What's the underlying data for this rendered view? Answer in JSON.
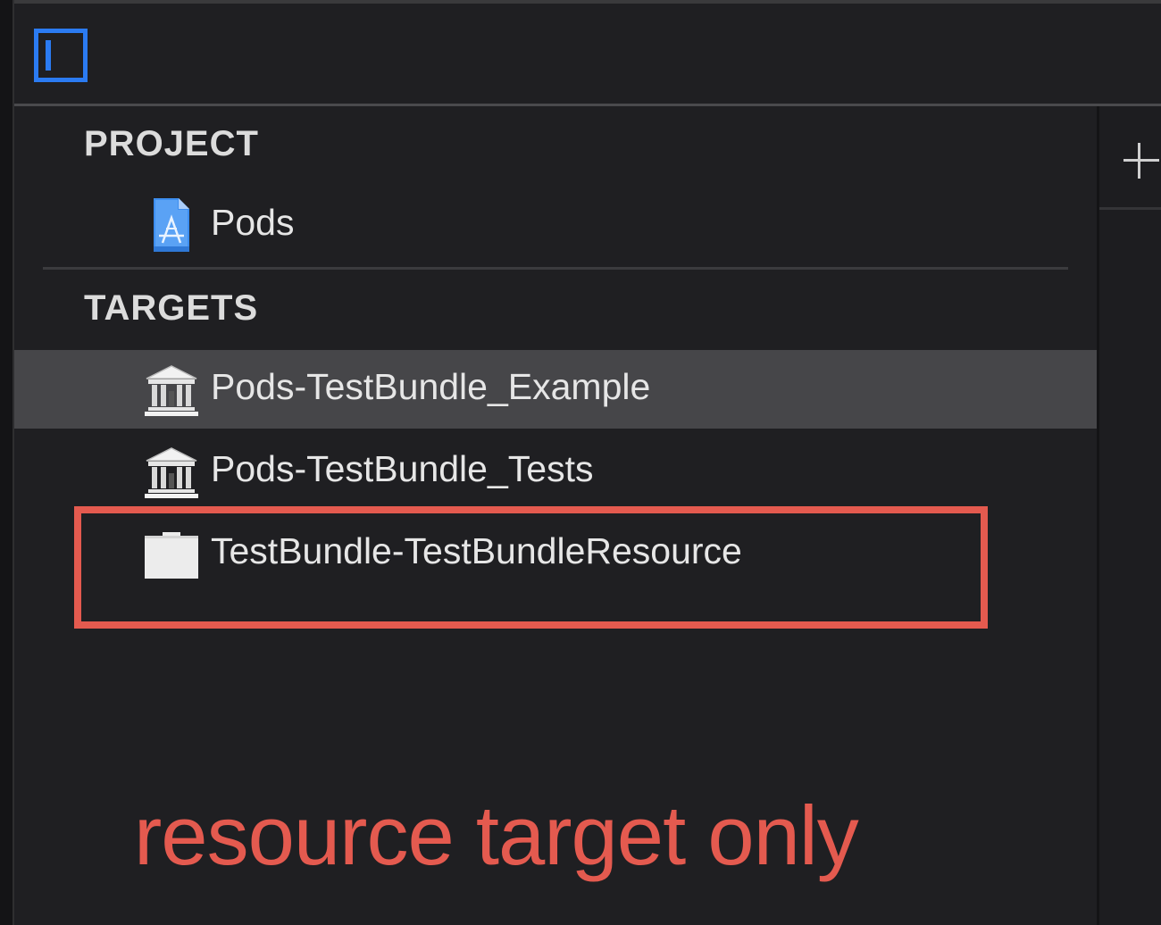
{
  "toolbar": {
    "sidebar_toggle_icon": "sidebar-left-icon",
    "accent_color": "#2b7bf2"
  },
  "project_section": {
    "header": "PROJECT",
    "items": [
      {
        "label": "Pods",
        "icon": "xcode-project-icon"
      }
    ]
  },
  "targets_section": {
    "header": "TARGETS",
    "items": [
      {
        "label": "Pods-TestBundle_Example",
        "icon": "framework-library-icon",
        "selected": true
      },
      {
        "label": "Pods-TestBundle_Tests",
        "icon": "framework-library-icon",
        "selected": false
      },
      {
        "label": "TestBundle-TestBundleResource",
        "icon": "bundle-icon",
        "selected": false
      }
    ]
  },
  "right_pane": {
    "add_icon": "plus-icon"
  },
  "annotation": {
    "text": "resource target only",
    "color": "#e45a4f"
  }
}
